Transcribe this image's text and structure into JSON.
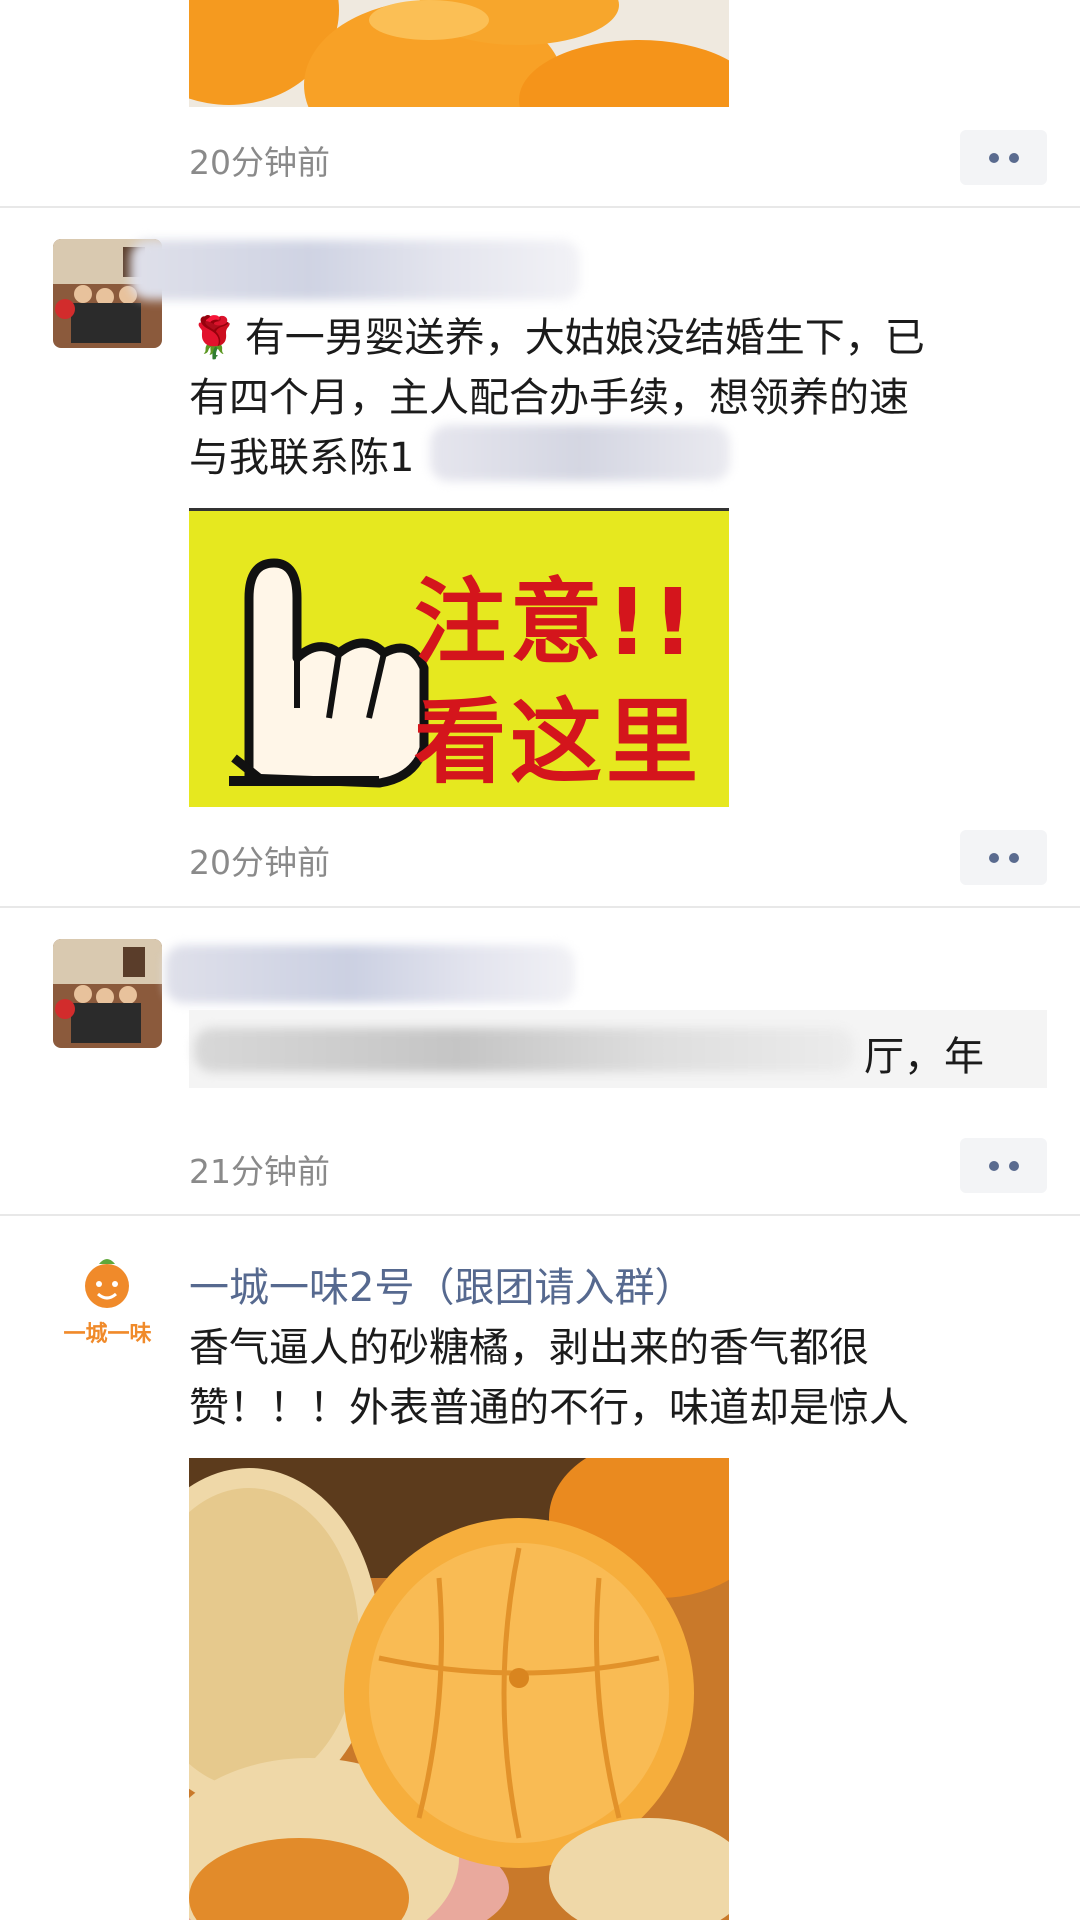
{
  "posts": [
    {
      "time": "20分钟前"
    },
    {
      "text_line1": "有一男婴送养，大姑娘没结婚生下，已",
      "text_line2": "有四个月，主人配合办手续，想领养的速",
      "text_line3_prefix": "与我联系陈1",
      "poster": {
        "line1": "注意!!",
        "line2": "看这里"
      },
      "time": "20分钟前"
    },
    {
      "text_visible": "厅，年",
      "time": "21分钟前"
    },
    {
      "nickname": "一城一味2号（跟团请入群）",
      "avatar_text": "一城一味",
      "text_line1": "香气逼人的砂糖橘，剥出来的香气都很",
      "text_line2": "赞！！！外表普通的不行，味道却是惊人"
    }
  ],
  "colors": {
    "nickname": "#56698f",
    "timestamp": "#8a8a8a",
    "poster_bg": "#e6e81f",
    "poster_text": "#d4151c"
  }
}
